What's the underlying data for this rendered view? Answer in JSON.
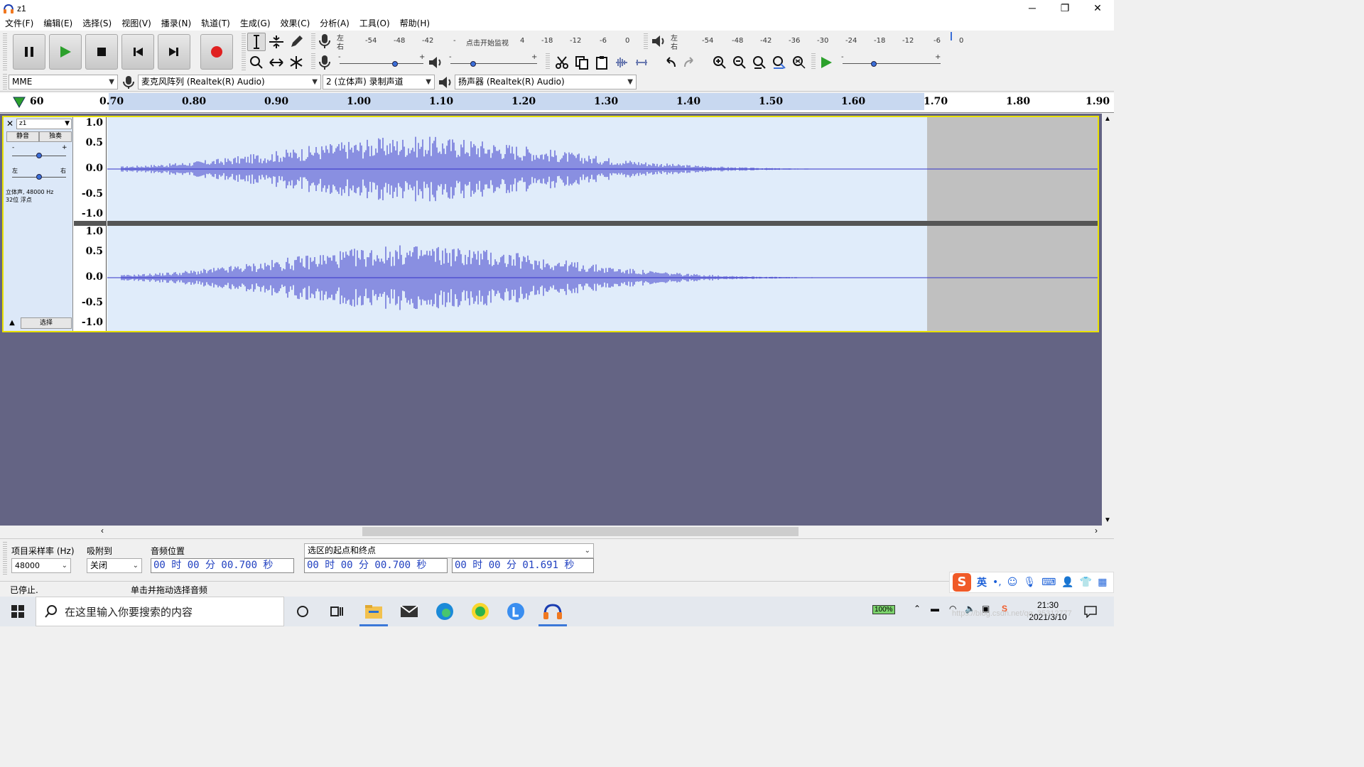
{
  "window": {
    "title": "z1",
    "min": "─",
    "restore": "❐",
    "close": "✕"
  },
  "menu": [
    "文件(F)",
    "编辑(E)",
    "选择(S)",
    "视图(V)",
    "播录(N)",
    "轨道(T)",
    "生成(G)",
    "效果(C)",
    "分析(A)",
    "工具(O)",
    "帮助(H)"
  ],
  "meters": {
    "rec_scale": [
      "-54",
      "-48",
      "-42",
      "-",
      "点击开始监视",
      "4",
      "-18",
      "-12",
      "-6",
      "0"
    ],
    "play_scale": [
      "-54",
      "-48",
      "-42",
      "-36",
      "-30",
      "-24",
      "-18",
      "-12",
      "-6",
      "0"
    ],
    "lr_top": "左",
    "lr_bottom": "右",
    "minus": "-",
    "plus": "+"
  },
  "devices": {
    "host": "MME",
    "input": "麦克风阵列 (Realtek(R) Audio)",
    "channels": "2 (立体声) 录制声道",
    "output": "扬声器 (Realtek(R) Audio)"
  },
  "ruler": {
    "ticks": [
      "60",
      "0.70",
      "0.80",
      "0.90",
      "1.00",
      "1.10",
      "1.20",
      "1.30",
      "1.40",
      "1.50",
      "1.60",
      "1.70",
      "1.80",
      "1.90"
    ]
  },
  "track": {
    "name": "z1",
    "mute": "静音",
    "solo": "独奏",
    "gain_minus": "-",
    "gain_plus": "+",
    "pan_left": "左",
    "pan_right": "右",
    "info_line1": "立体声, 48000 Hz",
    "info_line2": "32位 浮点",
    "select": "选择",
    "vruler": [
      "1.0",
      "0.5",
      "0.0",
      "-0.5",
      "-1.0"
    ]
  },
  "selection_bar": {
    "rate_label": "项目采样率 (Hz)",
    "rate_value": "48000",
    "snap_label": "吸附到",
    "snap_value": "关闭",
    "pos_label": "音频位置",
    "pos_value": "00 时 00 分 00.700 秒",
    "range_label": "选区的起点和终点",
    "start_value": "00 时 00 分 00.700 秒",
    "end_value": "00 时 00 分 01.691 秒"
  },
  "status": {
    "state": "已停止.",
    "hint": "单击并拖动选择音频"
  },
  "taskbar": {
    "search_placeholder": "在这里输入你要搜索的内容",
    "battery": "100%",
    "ime": "英",
    "time": "21:30",
    "date": "2021/3/10",
    "watermark": "https://blog.csdn.net/qq_35312777"
  },
  "colors": {
    "waveform": "#3232c8",
    "wave_bg": "#e0ecfa",
    "track_border": "#e8e000",
    "empty_bg": "#646484",
    "record": "#e02020",
    "play": "#2ca02c"
  }
}
